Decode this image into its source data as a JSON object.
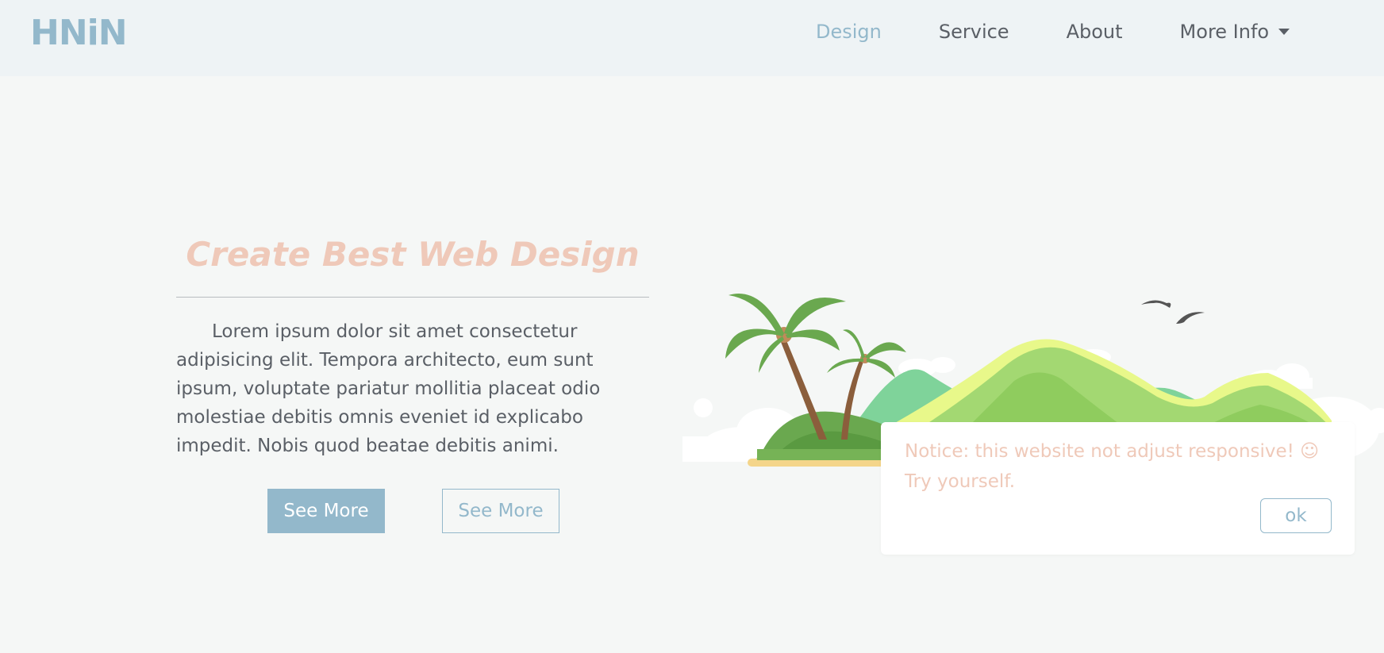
{
  "header": {
    "brand": "HNiN",
    "nav": [
      {
        "label": "Design",
        "active": true
      },
      {
        "label": "Service",
        "active": false
      },
      {
        "label": "About",
        "active": false
      }
    ],
    "dropdown_label": "More Info"
  },
  "hero": {
    "title": "Create Best Web Design",
    "body": "Lorem ipsum dolor sit amet consectetur adipisicing elit. Tempora architecto, eum sunt ipsum, voluptate pariatur mollitia placeat odio molestiae debitis omnis eveniet id explicabo impedit. Nobis quod beatae debitis animi.",
    "primary_button": "See More",
    "secondary_button": "See More"
  },
  "notice": {
    "message": "Notice: this website not adjust responsive! ☺ Try yourself.",
    "ok_label": "ok"
  },
  "colors": {
    "accent": "#93b8cb",
    "title": "#efc9b9",
    "nav_bg": "#eef3f5",
    "page_bg": "#f5f7f6"
  },
  "icons": {
    "illustration": "tropical-island-illustration",
    "caret": "chevron-down-icon"
  }
}
